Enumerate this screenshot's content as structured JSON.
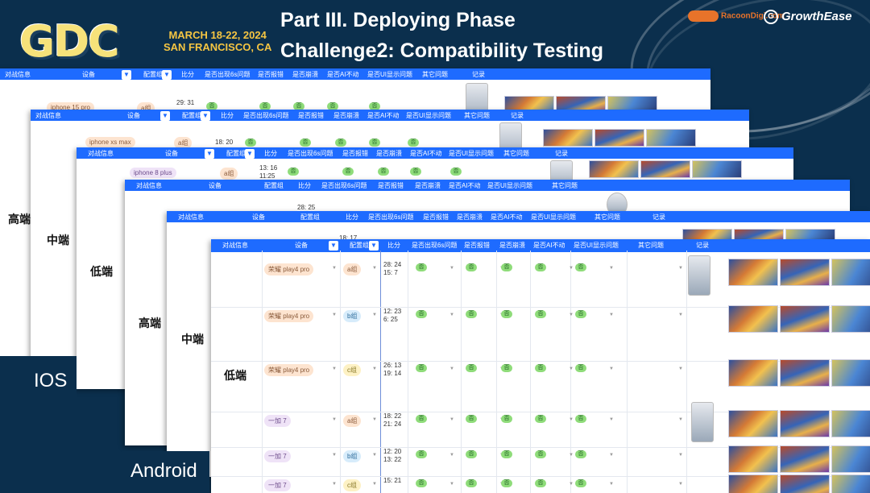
{
  "header": {
    "logo": "GDC",
    "event_dates": "MARCH 18-22, 2024",
    "event_location": "SAN FRANCISCO, CA",
    "title_line1": "Part III. Deploying Phase",
    "title_line2": "Challenge2: Compatibility Testing",
    "brand1": "RacoonDigi.com",
    "brand2": "GrowthEase"
  },
  "columns": {
    "c1": "对战信息",
    "c2": "设备",
    "c3": "配置组",
    "c4": "比分",
    "c5": "是否出现6s问题",
    "c6": "是否报错",
    "c7": "是否崩溃",
    "c8": "是否AI不动",
    "c9": "是否UI显示问题",
    "c10": "其它问题",
    "c11": "记录"
  },
  "tiers": {
    "ios_high": "高端",
    "ios_mid": "中端",
    "ios_low": "低端",
    "android_high": "高端",
    "android_mid": "中端",
    "android_low": "低端"
  },
  "platforms": {
    "ios": "IOS",
    "android": "Android"
  },
  "sheet_ios_high": {
    "device": "iphone 15 pro",
    "group": "a组",
    "score": "29: 31",
    "no": "否"
  },
  "sheet_ios_mid": {
    "device": "iphone xs max",
    "group": "a组",
    "score": "18: 20"
  },
  "sheet_ios_low": {
    "device": "iphone 8 plus",
    "group": "a组",
    "score": "13: 16\n11:25"
  },
  "sheet_and_high": {
    "score": "28: 25"
  },
  "sheet_and_mid": {
    "score": "18: 17"
  },
  "sheet_and_low": {
    "rows": [
      {
        "device": "荣耀 play4 pro",
        "group": "a组",
        "score": "28: 24\n15: 7"
      },
      {
        "device": "荣耀 play4 pro",
        "group": "b组",
        "score": "12: 23\n6: 25"
      },
      {
        "device": "荣耀 play4 pro",
        "group": "c组",
        "score": "26: 13\n19: 14"
      },
      {
        "device": "一加 7",
        "group": "a组",
        "score": "18: 22\n21: 24"
      },
      {
        "device": "一加 7",
        "group": "b组",
        "score": "12: 20\n13: 22"
      },
      {
        "device": "一加 7",
        "group": "c组",
        "score": "15: 21"
      }
    ],
    "no": "否"
  }
}
